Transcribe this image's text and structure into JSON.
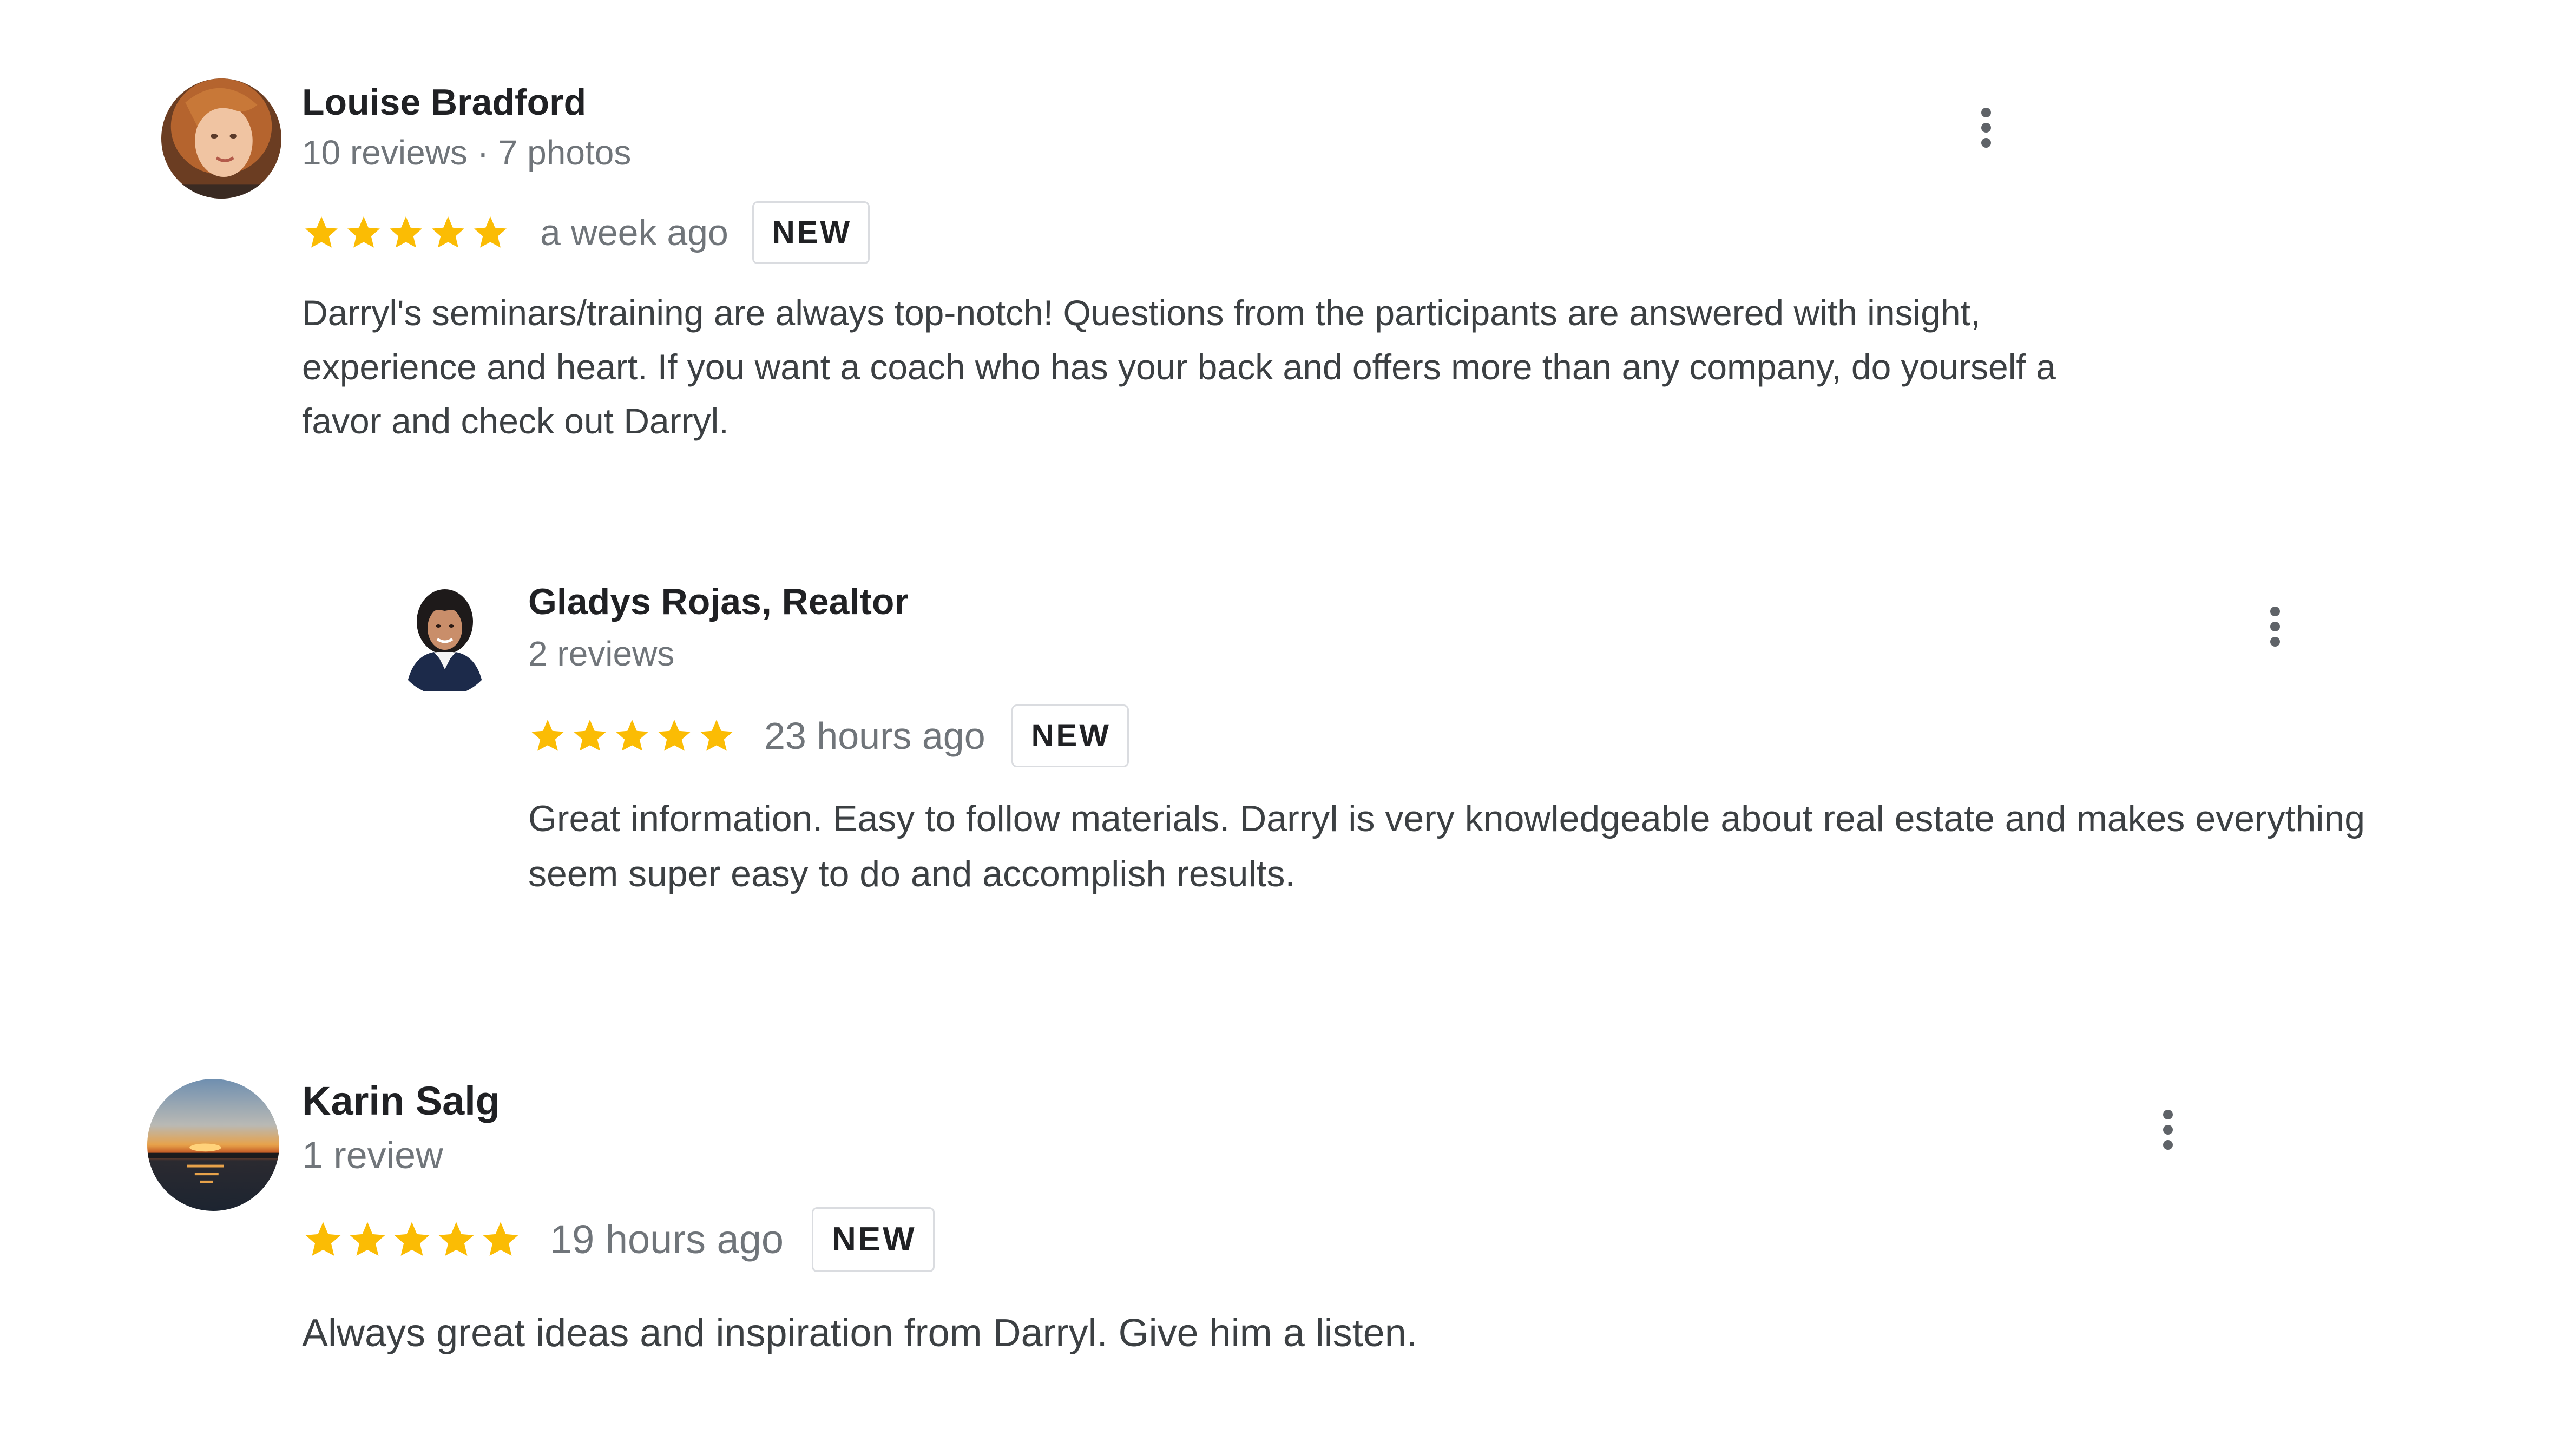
{
  "colors": {
    "star": "#fbbc04",
    "name": "#202124",
    "meta": "#70757a",
    "body_text": "#3c4043",
    "badge_border": "#dadce0",
    "menu_dots": "#5f6368"
  },
  "reviews": [
    {
      "author": "Louise Bradford",
      "stats": "10 reviews · 7 photos",
      "rating": 5,
      "time": "a week ago",
      "badge": "NEW",
      "text": "Darryl's seminars/training are always top-notch! Questions from the participants are answered with insight, experience and heart. If you want a coach who has your back and offers more than any company, do yourself a favor and check out Darryl.",
      "avatar_icon": "user-avatar-photo",
      "menu_icon": "more-vert-icon"
    },
    {
      "author": "Gladys Rojas, Realtor",
      "stats": "2 reviews",
      "rating": 5,
      "time": "23 hours ago",
      "badge": "NEW",
      "text": "Great information. Easy to follow materials. Darryl is very knowledgeable about real estate and makes everything seem super easy to do and accomplish results.",
      "avatar_icon": "user-avatar-photo",
      "menu_icon": "more-vert-icon"
    },
    {
      "author": "Karin Salg",
      "stats": "1 review",
      "rating": 5,
      "time": "19 hours ago",
      "badge": "NEW",
      "text": "Always great ideas and inspiration from Darryl. Give him a listen.",
      "avatar_icon": "sunset-avatar-photo",
      "menu_icon": "more-vert-icon"
    }
  ]
}
